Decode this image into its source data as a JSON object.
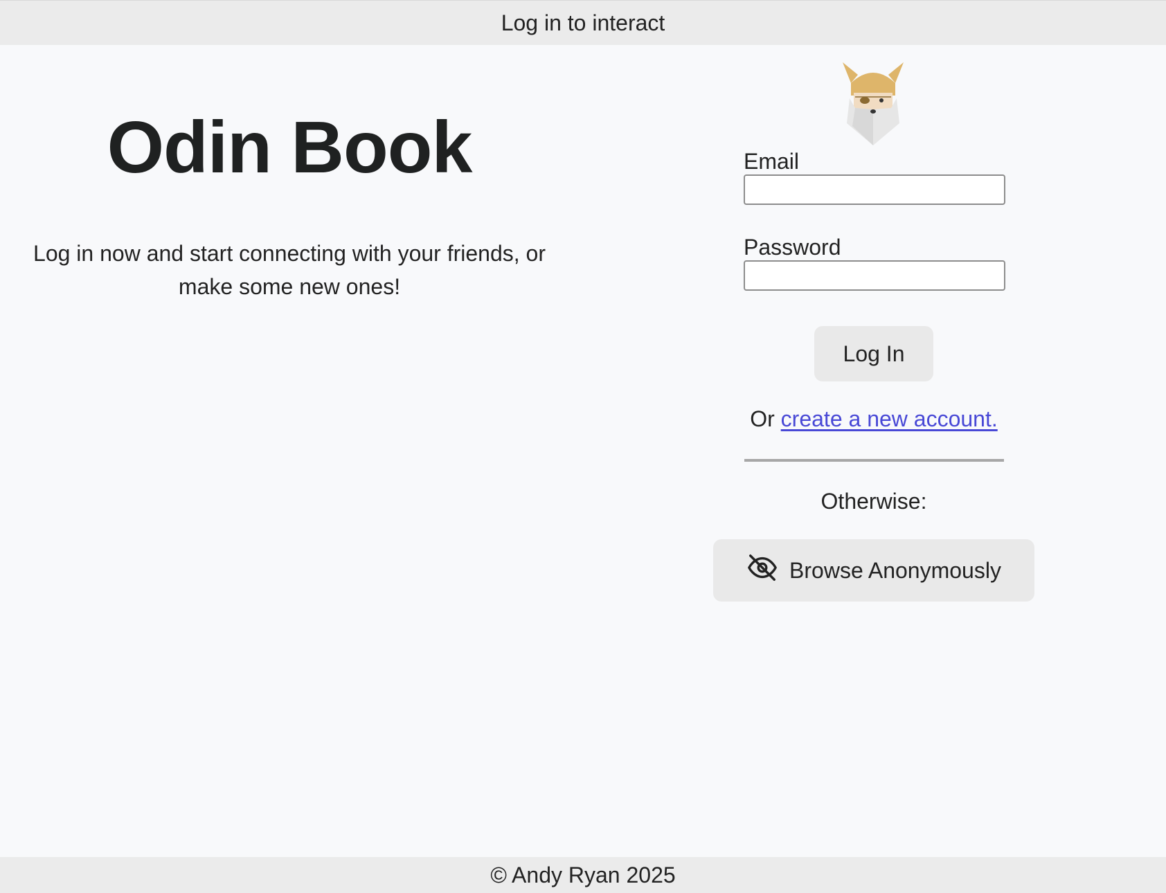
{
  "topbar": {
    "text": "Log in to interact"
  },
  "hero": {
    "title": "Odin Book",
    "tagline": "Log in now and start connecting with your friends, or make some new ones!"
  },
  "login": {
    "logo_icon": "odin-viking-logo",
    "email_label": "Email",
    "email_value": "",
    "password_label": "Password",
    "password_value": "",
    "login_button": "Log In",
    "signup_prefix": "Or",
    "signup_link": "create a new account.",
    "otherwise_text": "Otherwise:",
    "anon_icon": "eye-off-icon",
    "anon_button": "Browse Anonymously"
  },
  "footer": {
    "text": "© Andy Ryan 2025"
  },
  "colors": {
    "bar_bg": "#ebebeb",
    "page_bg": "#f8f9fb",
    "link": "#4848d6",
    "logo_gold": "#deb56a"
  }
}
